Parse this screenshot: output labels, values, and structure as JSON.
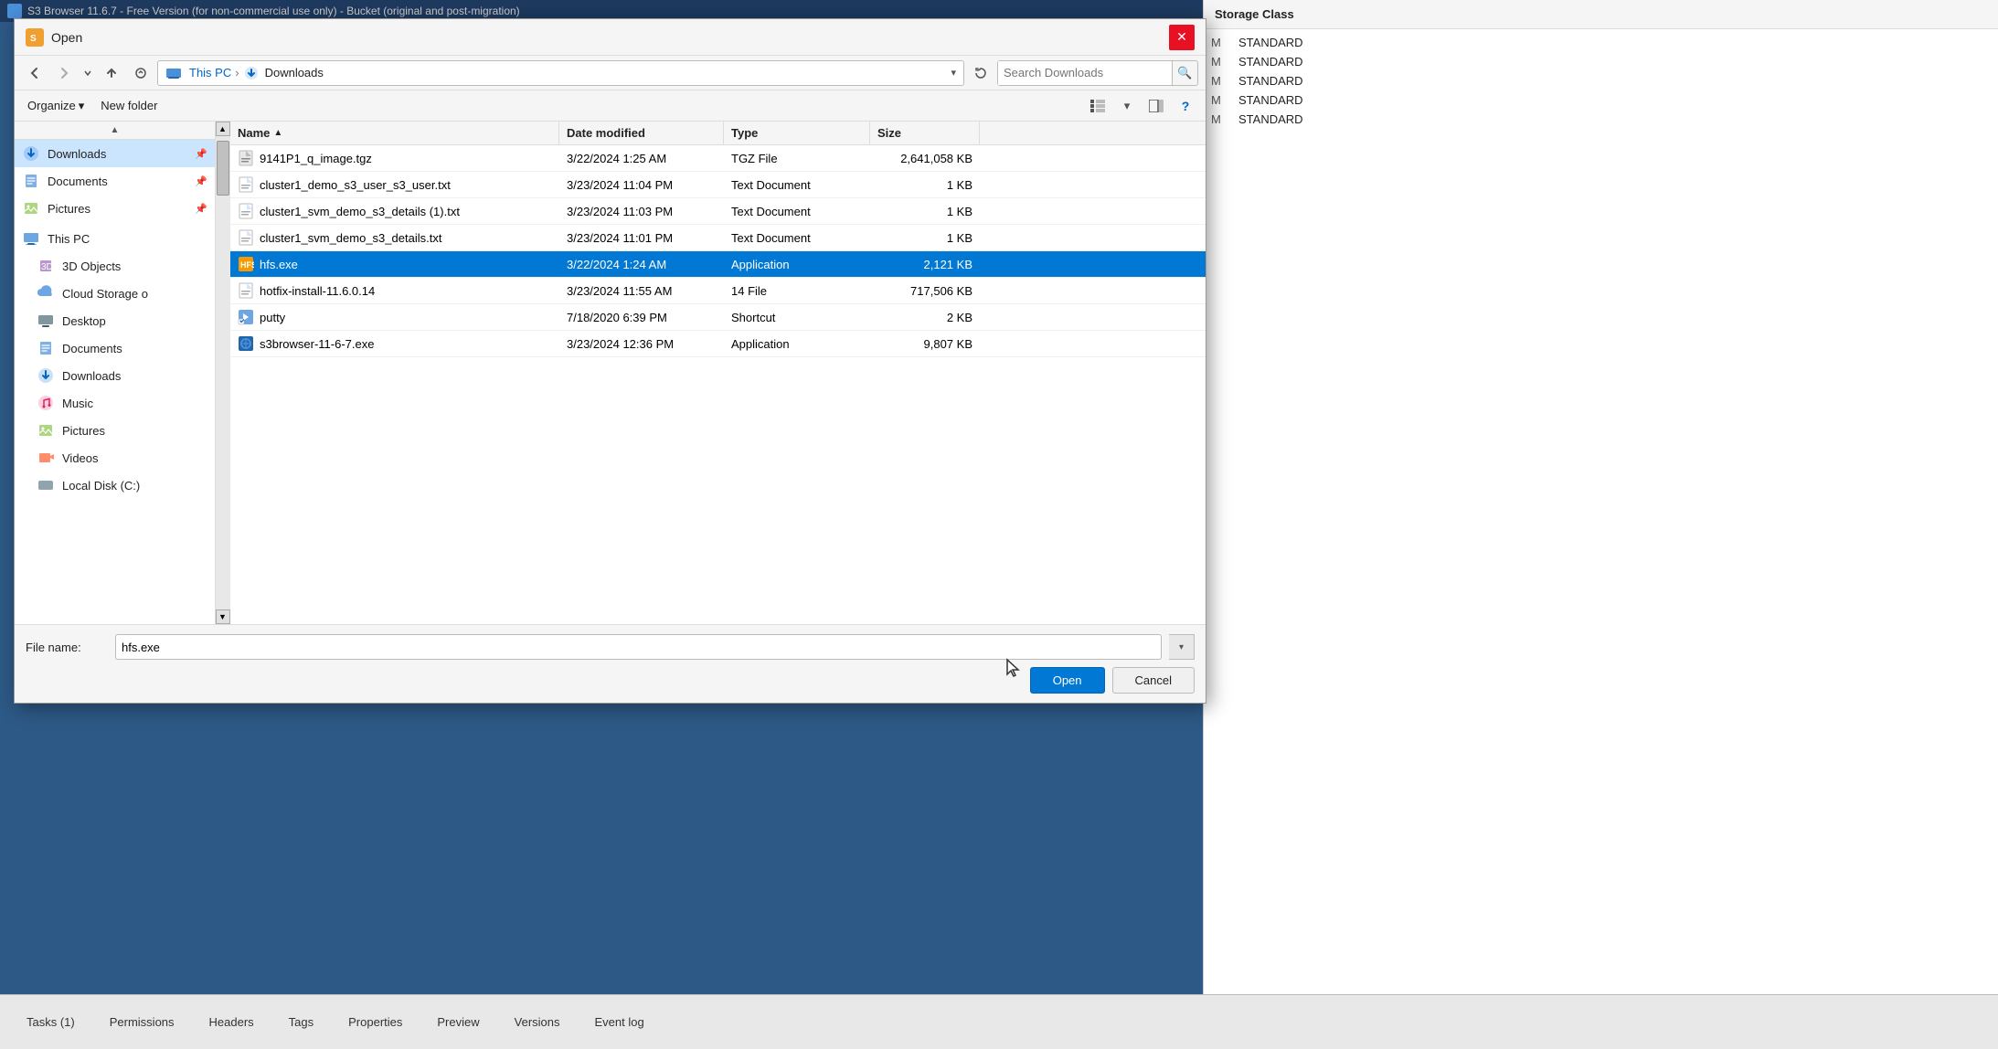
{
  "app": {
    "title": "S3 Browser 11.6.7 - Free Version (for non-commercial use only) - Bucket (original and post-migration)",
    "dialog_title": "Open",
    "dialog_icon_text": "S3"
  },
  "toolbar": {
    "organize_label": "Organize",
    "new_folder_label": "New folder"
  },
  "breadcrumb": {
    "this_pc": "This PC",
    "downloads": "Downloads"
  },
  "search": {
    "placeholder": "Search Downloads"
  },
  "file_list": {
    "columns": {
      "name": "Name",
      "date_modified": "Date modified",
      "type": "Type",
      "size": "Size"
    },
    "files": [
      {
        "name": "9141P1_q_image.tgz",
        "date": "3/22/2024 1:25 AM",
        "type": "TGZ File",
        "size": "2,641,058 KB",
        "icon": "📦",
        "selected": false
      },
      {
        "name": "cluster1_demo_s3_user_s3_user.txt",
        "date": "3/23/2024 11:04 PM",
        "type": "Text Document",
        "size": "1 KB",
        "icon": "📄",
        "selected": false
      },
      {
        "name": "cluster1_svm_demo_s3_details (1).txt",
        "date": "3/23/2024 11:03 PM",
        "type": "Text Document",
        "size": "1 KB",
        "icon": "📄",
        "selected": false
      },
      {
        "name": "cluster1_svm_demo_s3_details.txt",
        "date": "3/23/2024 11:01 PM",
        "type": "Text Document",
        "size": "1 KB",
        "icon": "📄",
        "selected": false
      },
      {
        "name": "hfs.exe",
        "date": "3/22/2024 1:24 AM",
        "type": "Application",
        "size": "2,121 KB",
        "icon": "⚙",
        "selected": true
      },
      {
        "name": "hotfix-install-11.6.0.14",
        "date": "3/23/2024 11:55 AM",
        "type": "14 File",
        "size": "717,506 KB",
        "icon": "📄",
        "selected": false
      },
      {
        "name": "putty",
        "date": "7/18/2020 6:39 PM",
        "type": "Shortcut",
        "size": "2 KB",
        "icon": "🔗",
        "selected": false
      },
      {
        "name": "s3browser-11-6-7.exe",
        "date": "3/23/2024 12:36 PM",
        "type": "Application",
        "size": "9,807 KB",
        "icon": "⚙",
        "selected": false
      }
    ]
  },
  "sidebar": {
    "items": [
      {
        "label": "Downloads",
        "icon": "⬇",
        "pinned": true,
        "active": true,
        "type": "downloads-quick"
      },
      {
        "label": "Documents",
        "icon": "📁",
        "pinned": true,
        "active": false,
        "type": "documents-quick"
      },
      {
        "label": "Pictures",
        "icon": "🖼",
        "pinned": true,
        "active": false,
        "type": "pictures-quick"
      },
      {
        "label": "This PC",
        "icon": "💻",
        "pinned": false,
        "active": false,
        "type": "this-pc"
      },
      {
        "label": "3D Objects",
        "icon": "📦",
        "pinned": false,
        "active": false,
        "type": "3d-objects"
      },
      {
        "label": "Cloud Storage o",
        "icon": "☁",
        "pinned": false,
        "active": false,
        "type": "cloud-storage"
      },
      {
        "label": "Desktop",
        "icon": "🖥",
        "pinned": false,
        "active": false,
        "type": "desktop"
      },
      {
        "label": "Documents",
        "icon": "📁",
        "pinned": false,
        "active": false,
        "type": "documents"
      },
      {
        "label": "Downloads",
        "icon": "⬇",
        "pinned": false,
        "active": false,
        "type": "downloads"
      },
      {
        "label": "Music",
        "icon": "🎵",
        "pinned": false,
        "active": false,
        "type": "music"
      },
      {
        "label": "Pictures",
        "icon": "🖼",
        "pinned": false,
        "active": false,
        "type": "pictures"
      },
      {
        "label": "Videos",
        "icon": "🎬",
        "pinned": false,
        "active": false,
        "type": "videos"
      },
      {
        "label": "Local Disk (C:)",
        "icon": "💾",
        "pinned": false,
        "active": false,
        "type": "local-disk"
      }
    ]
  },
  "filename_bar": {
    "label": "File name:",
    "value": "hfs.exe",
    "open_btn": "Open",
    "cancel_btn": "Cancel"
  },
  "storage_panel": {
    "header": "Storage Class",
    "rows": [
      {
        "prefix": "M",
        "value": "STANDARD"
      },
      {
        "prefix": "M",
        "value": "STANDARD"
      },
      {
        "prefix": "M",
        "value": "STANDARD"
      },
      {
        "prefix": "M",
        "value": "STANDARD"
      },
      {
        "prefix": "M",
        "value": "STANDARD"
      }
    ]
  },
  "bottom_tabs": {
    "tabs": [
      {
        "label": "Tasks (1)",
        "active": false
      },
      {
        "label": "Permissions",
        "active": false
      },
      {
        "label": "Headers",
        "active": false
      },
      {
        "label": "Tags",
        "active": false
      },
      {
        "label": "Properties",
        "active": false
      },
      {
        "label": "Preview",
        "active": false
      },
      {
        "label": "Versions",
        "active": false
      },
      {
        "label": "Event log",
        "active": false
      }
    ]
  }
}
